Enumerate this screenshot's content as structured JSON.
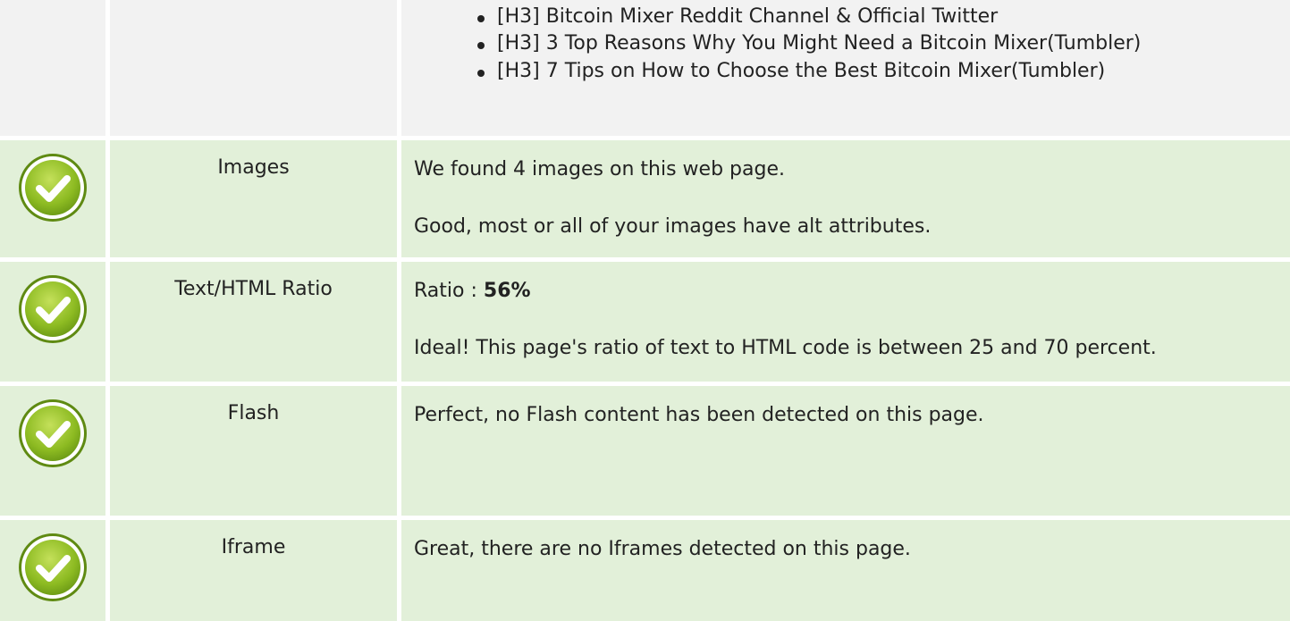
{
  "top": {
    "h3_items": [
      "[H3] Bitcoin Mixer Reddit Channel & Official Twitter",
      "[H3] 3 Top Reasons Why You Might Need a Bitcoin Mixer(Tumbler)",
      "[H3] 7 Tips on How to Choose the Best Bitcoin Mixer(Tumbler)"
    ]
  },
  "rows": [
    {
      "label": "Images",
      "line1": "We found 4 images on this web page.",
      "line2": "Good, most or all of your images have alt attributes.",
      "status_icon": "check-icon"
    },
    {
      "label": "Text/HTML Ratio",
      "line1_prefix": "Ratio : ",
      "line1_value": "56%",
      "line2": "Ideal! This page's ratio of text to HTML code is between 25 and 70 percent.",
      "status_icon": "check-icon"
    },
    {
      "label": "Flash",
      "line1": "Perfect, no Flash content has been detected on this page.",
      "status_icon": "check-icon"
    },
    {
      "label": "Iframe",
      "line1": "Great, there are no Iframes detected on this page.",
      "status_icon": "check-icon"
    }
  ],
  "colors": {
    "row_bg_grey": "#f2f2f2",
    "row_bg_green": "#e2f0d9",
    "check_green_light": "#b6d94a",
    "check_green_dark": "#6f9d17"
  }
}
